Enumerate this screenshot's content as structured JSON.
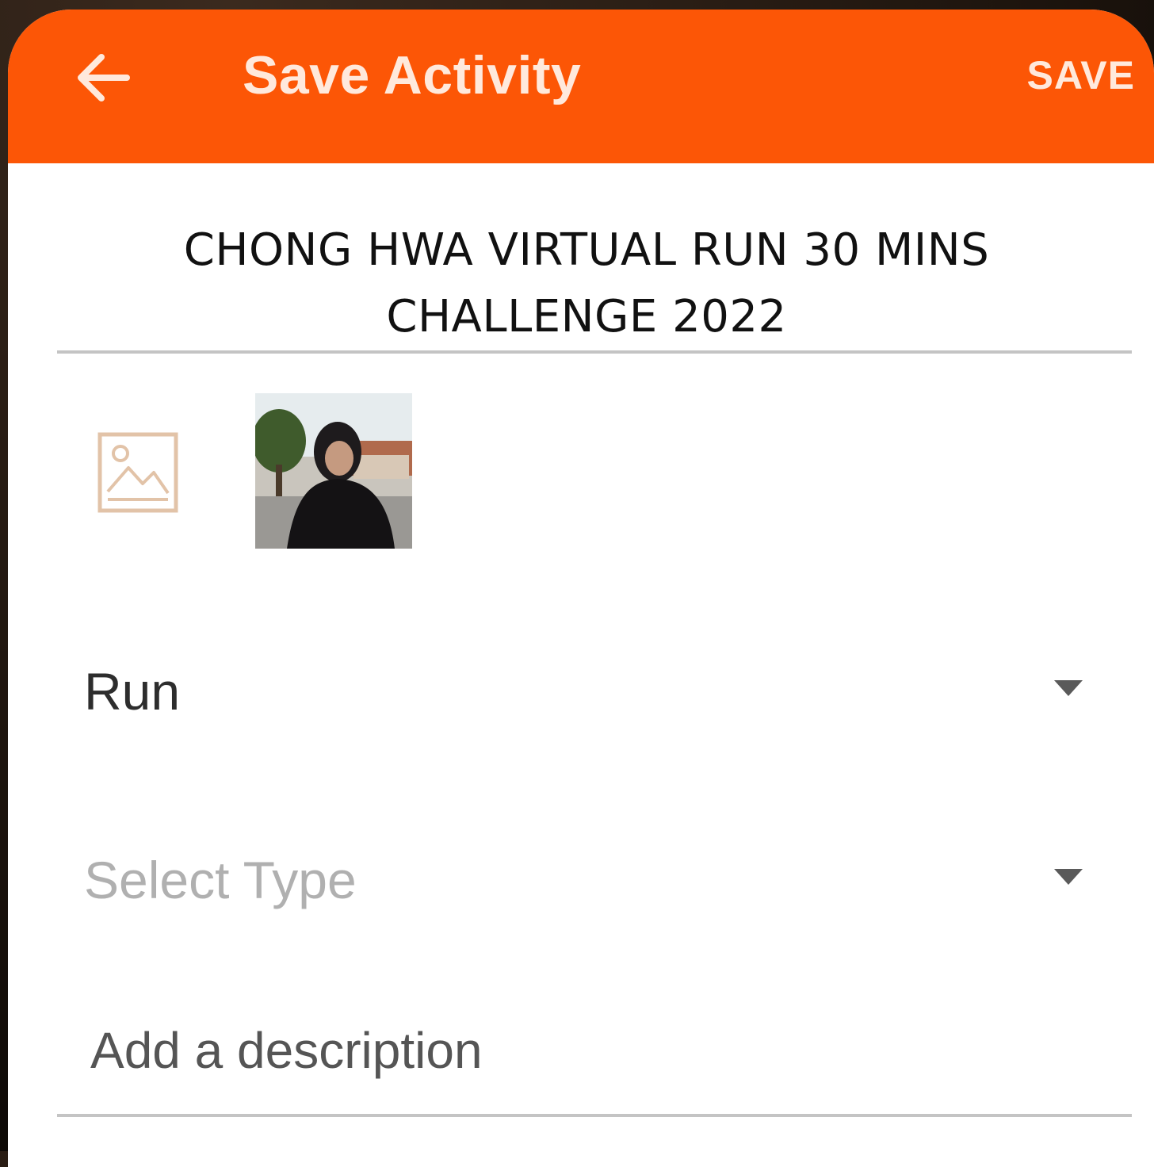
{
  "appbar": {
    "title": "Save Activity",
    "save_label": "SAVE",
    "back_icon": "arrow-left-icon",
    "color": "#fc5606"
  },
  "activity": {
    "title": "CHONG HWA VIRTUAL RUN 30 MINS CHALLENGE 2022"
  },
  "media": {
    "add_photo_icon": "image-icon",
    "photo_thumbnail": "photo-thumbnail"
  },
  "sport_dropdown": {
    "value": "Run"
  },
  "type_dropdown": {
    "placeholder": "Select Type"
  },
  "description": {
    "placeholder": "Add a description"
  }
}
